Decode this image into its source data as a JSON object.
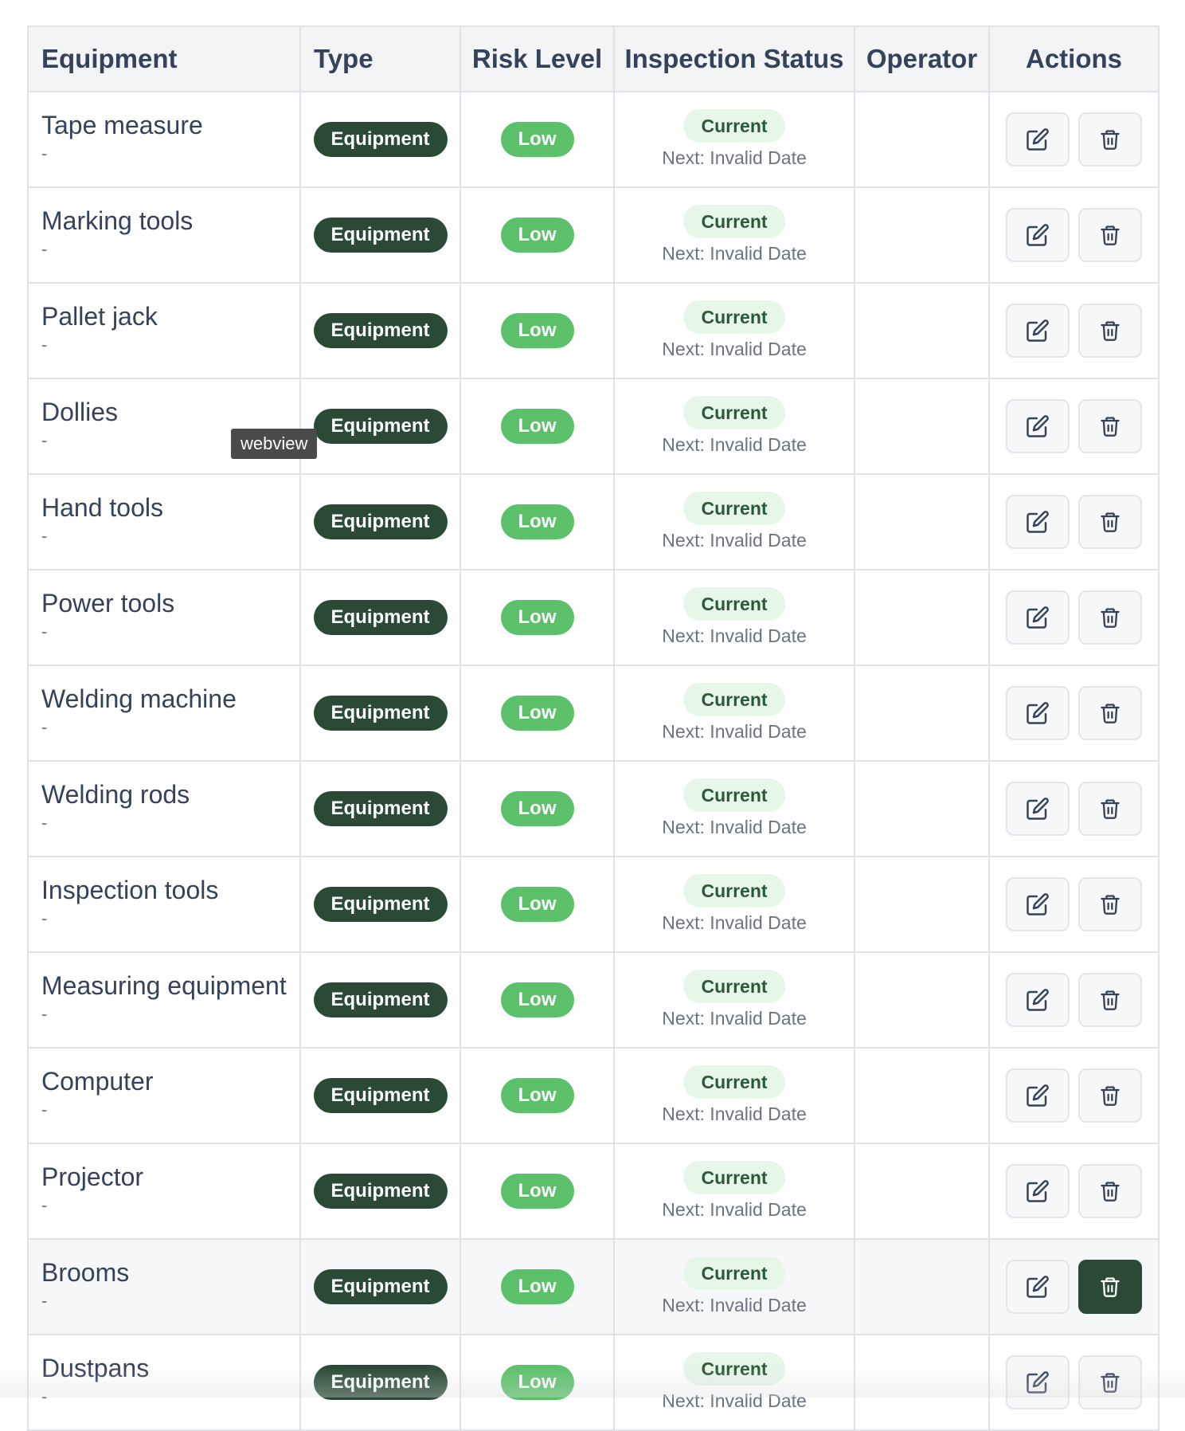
{
  "columns": {
    "equipment": "Equipment",
    "type": "Type",
    "risk_level": "Risk Level",
    "inspection_status": "Inspection Status",
    "operator": "Operator",
    "actions": "Actions"
  },
  "rows": [
    {
      "name": "Tape measure",
      "subtitle": "-",
      "type": "Equipment",
      "risk": "Low",
      "status": "Current",
      "next": "Next: Invalid Date",
      "operator": ""
    },
    {
      "name": "Marking tools",
      "subtitle": "-",
      "type": "Equipment",
      "risk": "Low",
      "status": "Current",
      "next": "Next: Invalid Date",
      "operator": ""
    },
    {
      "name": "Pallet jack",
      "subtitle": "-",
      "type": "Equipment",
      "risk": "Low",
      "status": "Current",
      "next": "Next: Invalid Date",
      "operator": ""
    },
    {
      "name": "Dollies",
      "subtitle": "-",
      "type": "Equipment",
      "risk": "Low",
      "status": "Current",
      "next": "Next: Invalid Date",
      "operator": ""
    },
    {
      "name": "Hand tools",
      "subtitle": "-",
      "type": "Equipment",
      "risk": "Low",
      "status": "Current",
      "next": "Next: Invalid Date",
      "operator": ""
    },
    {
      "name": "Power tools",
      "subtitle": "-",
      "type": "Equipment",
      "risk": "Low",
      "status": "Current",
      "next": "Next: Invalid Date",
      "operator": ""
    },
    {
      "name": "Welding machine",
      "subtitle": "-",
      "type": "Equipment",
      "risk": "Low",
      "status": "Current",
      "next": "Next: Invalid Date",
      "operator": ""
    },
    {
      "name": "Welding rods",
      "subtitle": "-",
      "type": "Equipment",
      "risk": "Low",
      "status": "Current",
      "next": "Next: Invalid Date",
      "operator": ""
    },
    {
      "name": "Inspection tools",
      "subtitle": "-",
      "type": "Equipment",
      "risk": "Low",
      "status": "Current",
      "next": "Next: Invalid Date",
      "operator": ""
    },
    {
      "name": "Measuring equipment",
      "subtitle": "-",
      "type": "Equipment",
      "risk": "Low",
      "status": "Current",
      "next": "Next: Invalid Date",
      "operator": ""
    },
    {
      "name": "Computer",
      "subtitle": "-",
      "type": "Equipment",
      "risk": "Low",
      "status": "Current",
      "next": "Next: Invalid Date",
      "operator": ""
    },
    {
      "name": "Projector",
      "subtitle": "-",
      "type": "Equipment",
      "risk": "Low",
      "status": "Current",
      "next": "Next: Invalid Date",
      "operator": ""
    },
    {
      "name": "Brooms",
      "subtitle": "-",
      "type": "Equipment",
      "risk": "Low",
      "status": "Current",
      "next": "Next: Invalid Date",
      "operator": "",
      "hovered": true
    },
    {
      "name": "Dustpans",
      "subtitle": "-",
      "type": "Equipment",
      "risk": "Low",
      "status": "Current",
      "next": "Next: Invalid Date",
      "operator": ""
    }
  ],
  "tooltip": "webview",
  "colors": {
    "type_badge": "#2a4a35",
    "risk_low": "#5cc06a",
    "status_current_bg": "#e6f6e9",
    "status_current_text": "#2a5a35"
  },
  "icons": {
    "edit": "edit-icon",
    "delete": "trash-icon"
  }
}
